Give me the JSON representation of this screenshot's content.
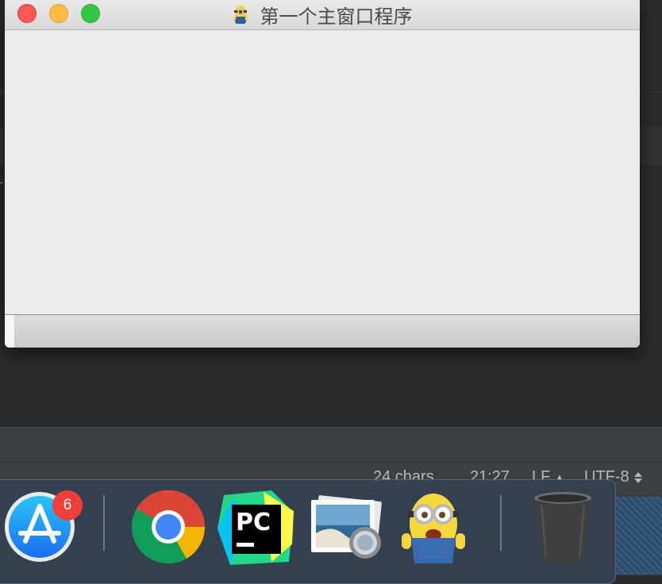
{
  "window": {
    "title": "第一个主窗口程序",
    "icon": "minion-app-icon"
  },
  "ide_status": {
    "chars": "24 chars",
    "position": "21:27",
    "line_ending": "LF",
    "encoding": "UTF-8"
  },
  "dock": {
    "items": [
      {
        "name": "App Store",
        "icon": "app-store-icon",
        "badge": "6"
      },
      {
        "name": "Google Chrome",
        "icon": "chrome-icon"
      },
      {
        "name": "PyCharm",
        "icon": "pycharm-icon",
        "label": "PC"
      },
      {
        "name": "Preview",
        "icon": "preview-icon"
      },
      {
        "name": "Python App",
        "icon": "minion-app-icon"
      },
      {
        "name": "Trash",
        "icon": "trash-icon"
      }
    ]
  },
  "colors": {
    "close": "#fc5753",
    "minimize": "#fdbc40",
    "maximize": "#33c748",
    "badge": "#ef3f38"
  }
}
